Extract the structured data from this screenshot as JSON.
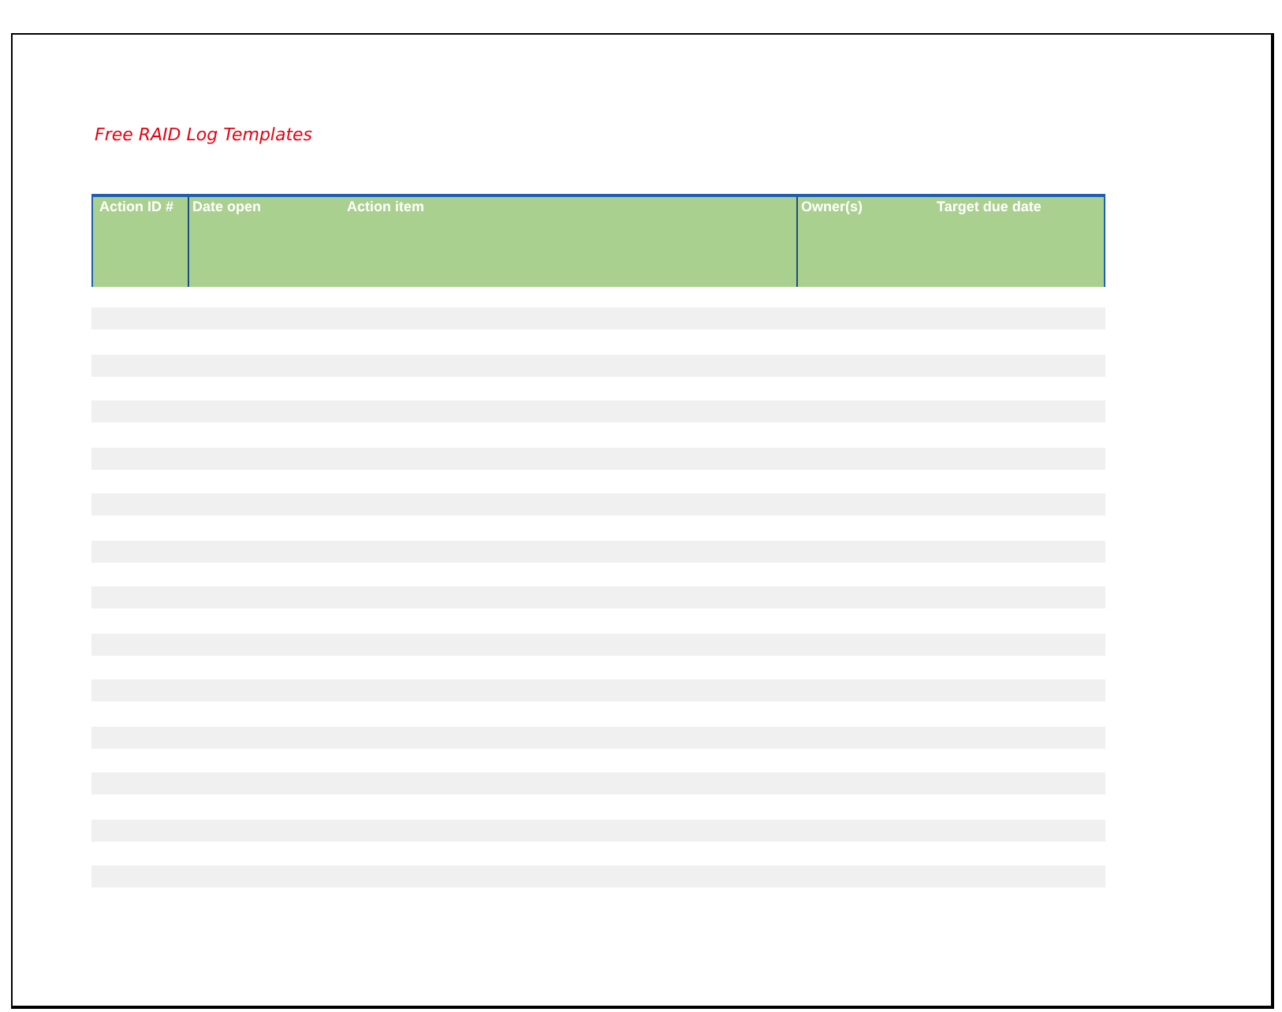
{
  "title": "Free RAID Log Templates",
  "table": {
    "header_cells": [
      {
        "labels": [
          "Action ID #"
        ]
      },
      {
        "labels": [
          "Date open",
          "Action item"
        ]
      },
      {
        "labels": [
          "Owner(s)",
          "Target due date"
        ]
      }
    ]
  }
}
